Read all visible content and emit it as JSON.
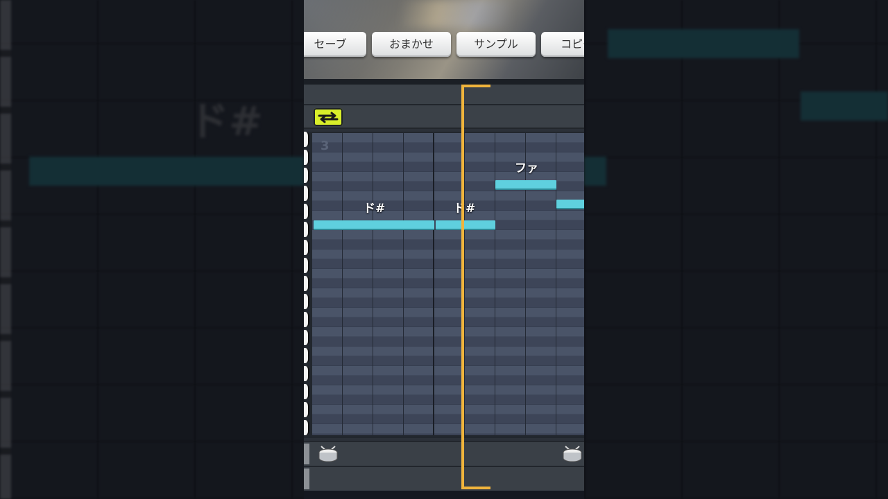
{
  "toolbar": {
    "save_label": "セーブ",
    "auto_label": "おまかせ",
    "sample_label": "サンプル",
    "copy_label": "コピー"
  },
  "editor": {
    "measure_number": "3",
    "notes": [
      {
        "label": "ド#"
      },
      {
        "label": "ド#"
      },
      {
        "label": "ファ"
      }
    ]
  },
  "backdrop": {
    "note_label": "ド#"
  },
  "colors": {
    "note": "#5fd0de",
    "playhead": "#f0b43c",
    "loop_button": "#d9ee2a"
  },
  "icons": [
    "loop-icon",
    "snare-drum-icon"
  ]
}
